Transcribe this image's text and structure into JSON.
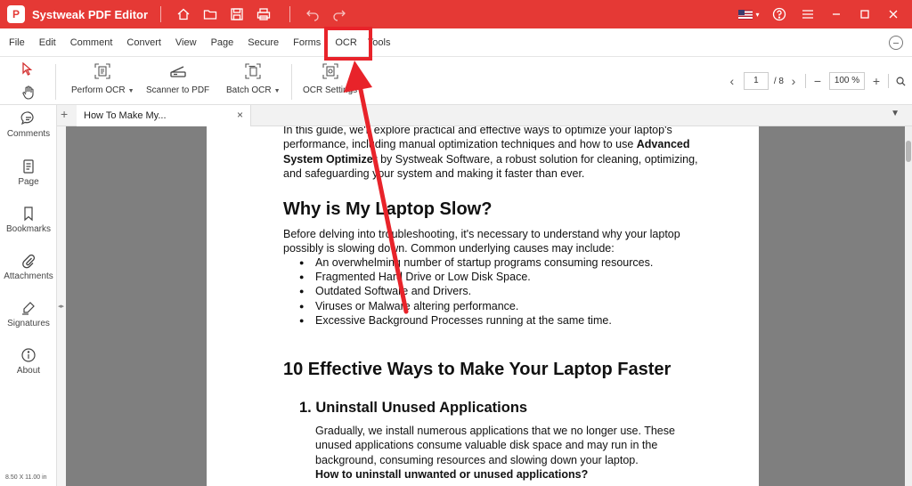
{
  "titlebar": {
    "app_title": "Systweak PDF Editor",
    "logo_letter": "P",
    "icons": [
      "home-icon",
      "folder-icon",
      "save-icon",
      "print-icon",
      "undo-icon",
      "redo-icon"
    ],
    "right_icons": [
      "flag-us-icon",
      "help-icon",
      "hamburger-icon",
      "minimize-icon",
      "maximize-icon",
      "close-icon"
    ],
    "color": "#e53935"
  },
  "menu": {
    "items": [
      "File",
      "Edit",
      "Comment",
      "Convert",
      "View",
      "Page",
      "Secure",
      "Forms",
      "OCR",
      "Tools"
    ]
  },
  "toolbar": {
    "perform_ocr": "Perform OCR",
    "scanner_to_pdf": "Scanner to PDF",
    "batch_ocr": "Batch OCR",
    "ocr_settings": "OCR Settings",
    "page_current": "1",
    "page_total": "/ 8",
    "zoom": "100 %"
  },
  "sidebar": {
    "items": [
      "Comments",
      "Page",
      "Bookmarks",
      "Attachments",
      "Signatures",
      "About"
    ],
    "page_size": "8.50 X 11.00 in"
  },
  "tabs": {
    "active": "How To Make My...",
    "close": "×",
    "add": "+"
  },
  "document": {
    "intro_l1": "In this guide, we'll explore practical and effective ways to optimize your laptop's",
    "intro_l2a": "performance, including manual optimization techniques and how to use ",
    "intro_l2b": "Advanced",
    "intro_l3a": "System Optimizer",
    "intro_l3b": " by Systweak Software, a robust solution for cleaning, optimizing,",
    "intro_l4": "and safeguarding your system and making it faster than ever.",
    "h_slow": "Why is My Laptop Slow?",
    "slow_p1": "Before delving into troubleshooting, it's necessary to understand why your laptop",
    "slow_p2": "possibly is slowing down. Common underlying causes may include:",
    "bullets": [
      "An overwhelming number of startup programs consuming resources.",
      "Fragmented Hard Drive or Low Disk Space.",
      "Outdated Software and Drivers.",
      "Viruses or Malware altering performance.",
      "Excessive Background Processes running at the same time."
    ],
    "h_ways": "10 Effective Ways to Make Your Laptop Faster",
    "h_uninstall": "1. Uninstall Unused Applications",
    "un_p1": "Gradually, we install numerous applications that we no longer use. These",
    "un_p2": "unused applications consume valuable disk space and may run in the",
    "un_p3": "background, consuming resources and slowing down your laptop.",
    "un_q": "How to uninstall unwanted or unused applications?"
  },
  "annotation": {
    "color": "#e8232a"
  }
}
